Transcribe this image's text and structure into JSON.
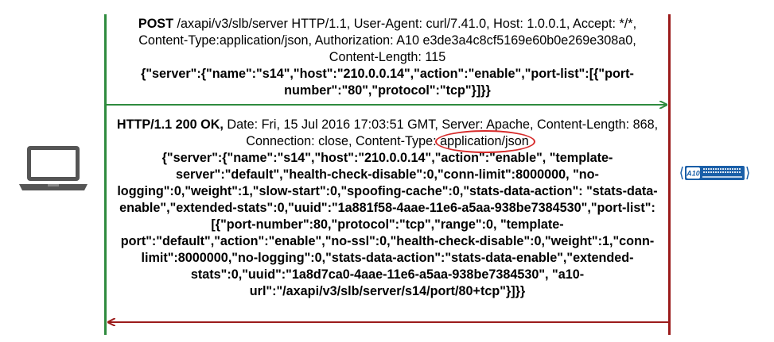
{
  "colors": {
    "client_line": "#2e8b3e",
    "server_line": "#9b1b1b",
    "request_arrow": "#2e8b3e",
    "response_arrow": "#9b1b1b",
    "highlight_oval": "#d62a2a",
    "laptop": "#555555",
    "device_body": "#1a5fa8"
  },
  "icons": {
    "client": "laptop-icon",
    "server": "a10-appliance-icon"
  },
  "device": {
    "logo_text": "A10"
  },
  "request": {
    "method": "POST",
    "headers": " /axapi/v3/slb/server HTTP/1.1, User-Agent: curl/7.41.0, Host: 1.0.0.1, Accept: */*, Content-Type:application/json, Authorization: A10 e3de3a4c8cf5169e60b0e269e308a0, Content-Length: 115",
    "body": "{\"server\":{\"name\":\"s14\",\"host\":\"210.0.0.14\",\"action\":\"enable\",\"port-list\":[{\"port-number\":\"80\",\"protocol\":\"tcp\"}]}}"
  },
  "response": {
    "status": "HTTP/1.1 200 OK,",
    "headers_before": " Date: Fri, 15 Jul 2016 17:03:51 GMT, Server: Apache, Content-Length: 868, Connection: close, Content-Type: ",
    "content_type": "application/json",
    "body": "{\"server\":{\"name\":\"s14\",\"host\":\"210.0.0.14\",\"action\":\"enable\", \"template-server\":\"default\",\"health-check-disable\":0,\"conn-limit\":8000000, \"no-logging\":0,\"weight\":1,\"slow-start\":0,\"spoofing-cache\":0,\"stats-data-action\": \"stats-data-enable\",\"extended-stats\":0,\"uuid\":\"1a881f58-4aae-11e6-a5aa-938be7384530\",\"port-list\":[{\"port-number\":80,\"protocol\":\"tcp\",\"range\":0, \"template-port\":\"default\",\"action\":\"enable\",\"no-ssl\":0,\"health-check-disable\":0,\"weight\":1,\"conn-limit\":8000000,\"no-logging\":0,\"stats-data-action\":\"stats-data-enable\",\"extended-stats\":0,\"uuid\":\"1a8d7ca0-4aae-11e6-a5aa-938be7384530\", \"a10-url\":\"/axapi/v3/slb/server/s14/port/80+tcp\"}]}}"
  }
}
